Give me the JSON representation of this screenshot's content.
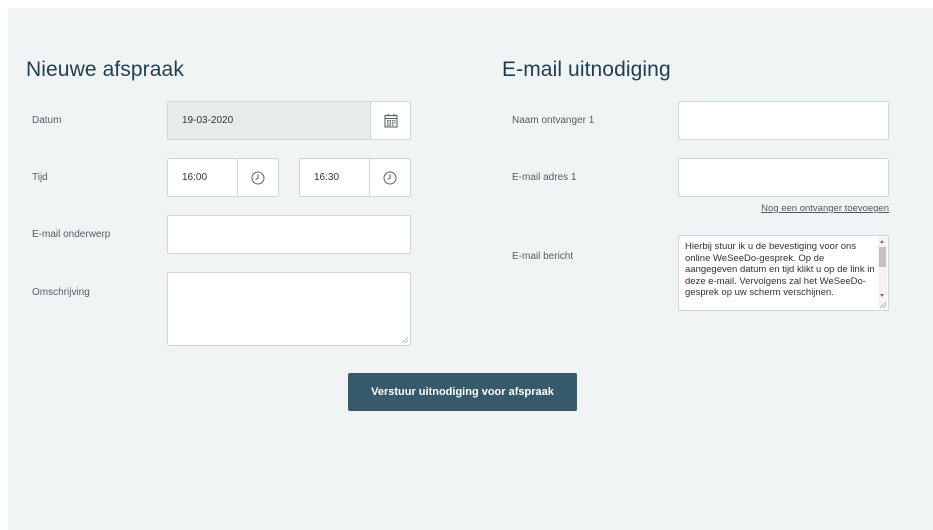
{
  "appointment": {
    "title": "Nieuwe afspraak",
    "date_label": "Datum",
    "date_value": "19-03-2020",
    "time_label": "Tijd",
    "start_time": "16:00",
    "end_time": "16:30",
    "subject_label": "E-mail onderwerp",
    "subject_value": "",
    "description_label": "Omschrijving",
    "description_value": ""
  },
  "invitation": {
    "title": "E-mail uitnodiging",
    "recipient_name_label": "Naam ontvanger 1",
    "recipient_name_value": "",
    "recipient_email_label": "E-mail adres 1",
    "recipient_email_value": "",
    "add_recipient_link": "Nog een ontvanger toevoegen",
    "message_label": "E-mail bericht",
    "message_value": "Hierbij stuur ik u de bevestiging voor ons online WeSeeDo-gesprek. Op de aangegeven datum en tijd klikt u op de link in deze e-mail. Vervolgens zal het WeSeeDo-gesprek op uw scherm verschijnen."
  },
  "submit_label": "Verstuur uitnodiging voor afspraak",
  "colors": {
    "panel_background": "#f1f4f5",
    "heading": "#1f3f4f",
    "button_background": "#36596b",
    "button_text": "#ffffff",
    "field_border": "#cfd6d9",
    "disabled_field": "#e8ebec"
  },
  "icons": {
    "date_picker": "calendar-icon",
    "start_time": "clock-icon",
    "end_time": "clock-icon"
  }
}
